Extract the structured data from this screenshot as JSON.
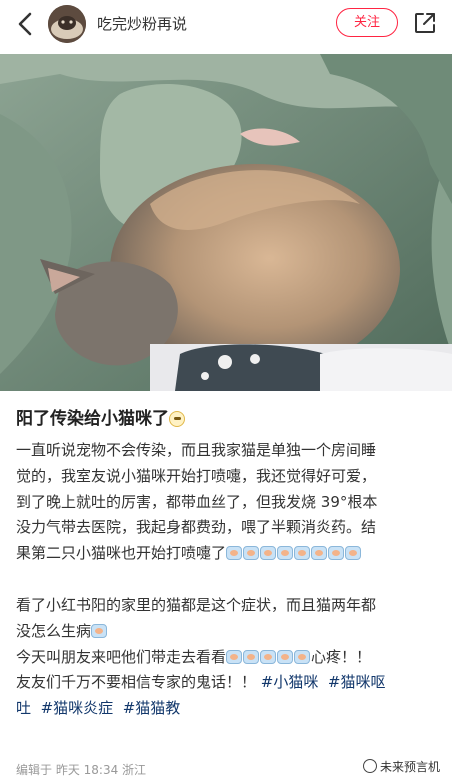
{
  "header": {
    "author_name": "吃完炒粉再说",
    "follow_label": "关注"
  },
  "post": {
    "title": "阳了传染给小猫咪了",
    "paragraph1": [
      "一直听说宠物不会传染，而且我家猫是单独一个房间睡",
      "觉的，我室友说小猫咪开始打喷嚏，我还觉得好可爱，",
      "到了晚上就吐的厉害，都带血丝了，但我发烧 39°根本",
      "没力气带去医院，我起身都费劲，喂了半颗消炎药。结",
      "果第二只小猫咪也开始打喷嚏了"
    ],
    "paragraph2": [
      "看了小红书阳的家里的猫都是这个症状，而且猫两年都",
      "没怎么生病"
    ],
    "line_today": "今天叫朋友来吧他们带走去看看",
    "line_today_end": "心疼！！",
    "line_warning": "友友们千万不要相信专家的鬼话！！",
    "tags": [
      "#小猫咪",
      "#猫咪呕",
      "吐",
      "#猫咪炎症",
      "#猫猫教"
    ]
  },
  "meta": {
    "edited": "编辑于  昨天 18:34  浙江"
  },
  "watermark": {
    "text": "未来预言机"
  },
  "icons": {
    "back": "chevron-left-icon",
    "share": "share-icon",
    "emoji": "sick-face-emoji-icon",
    "title_emoji": "crying-face-emoji-icon"
  },
  "colors": {
    "accent": "#ff2442",
    "tag": "#13386c",
    "meta": "#999999"
  }
}
